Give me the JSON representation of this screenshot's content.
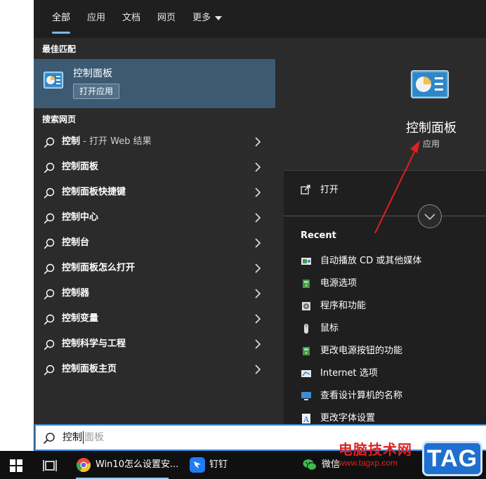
{
  "tabs": [
    {
      "label": "全部",
      "active": true
    },
    {
      "label": "应用",
      "active": false
    },
    {
      "label": "文档",
      "active": false
    },
    {
      "label": "网页",
      "active": false
    },
    {
      "label": "更多",
      "active": false,
      "has_dropdown": true
    }
  ],
  "best_match": {
    "header": "最佳匹配",
    "title": "控制面板",
    "open_button": "打开应用",
    "icon": "control-panel-icon"
  },
  "web_search": {
    "header": "搜索网页",
    "items": [
      {
        "bold": "控制",
        "sub": " - 打开 Web 结果"
      },
      {
        "bold": "控制面板",
        "sub": ""
      },
      {
        "bold": "控制面板快捷键",
        "sub": ""
      },
      {
        "bold": "控制中心",
        "sub": ""
      },
      {
        "bold": "控制台",
        "sub": ""
      },
      {
        "bold": "控制面板怎么打开",
        "sub": ""
      },
      {
        "bold": "控制器",
        "sub": ""
      },
      {
        "bold": "控制变量",
        "sub": ""
      },
      {
        "bold": "控制科学与工程",
        "sub": ""
      },
      {
        "bold": "控制面板主页",
        "sub": ""
      }
    ]
  },
  "detail": {
    "title": "控制面板",
    "subtitle": "应用",
    "open_label": "打开",
    "recent_header": "Recent",
    "recent": [
      {
        "label": "自动播放 CD 或其他媒体",
        "icon": "autoplay-icon"
      },
      {
        "label": "电源选项",
        "icon": "power-options-icon"
      },
      {
        "label": "程序和功能",
        "icon": "programs-icon"
      },
      {
        "label": "鼠标",
        "icon": "mouse-icon"
      },
      {
        "label": "更改电源按钮的功能",
        "icon": "power-button-icon"
      },
      {
        "label": "Internet 选项",
        "icon": "internet-options-icon"
      },
      {
        "label": "查看设计算机的名称",
        "icon": "computer-name-icon"
      },
      {
        "label": "更改字体设置",
        "icon": "font-icon"
      }
    ]
  },
  "search_box": {
    "typed": "控制",
    "suggestion": "面板"
  },
  "taskbar": {
    "apps": [
      {
        "label": "Win10怎么设置安...",
        "icon": "chrome-icon"
      },
      {
        "label": "钉钉",
        "icon": "dingtalk-icon"
      },
      {
        "label": "微信",
        "icon": "wechat-icon"
      }
    ]
  },
  "watermark": {
    "title": "电脑技术网",
    "url": "www.tagxp.com",
    "tag": "TAG"
  },
  "colors": {
    "accent": "#3b8ee0",
    "best_match_bg": "#3d5a73",
    "annotation_red": "#e02020"
  }
}
